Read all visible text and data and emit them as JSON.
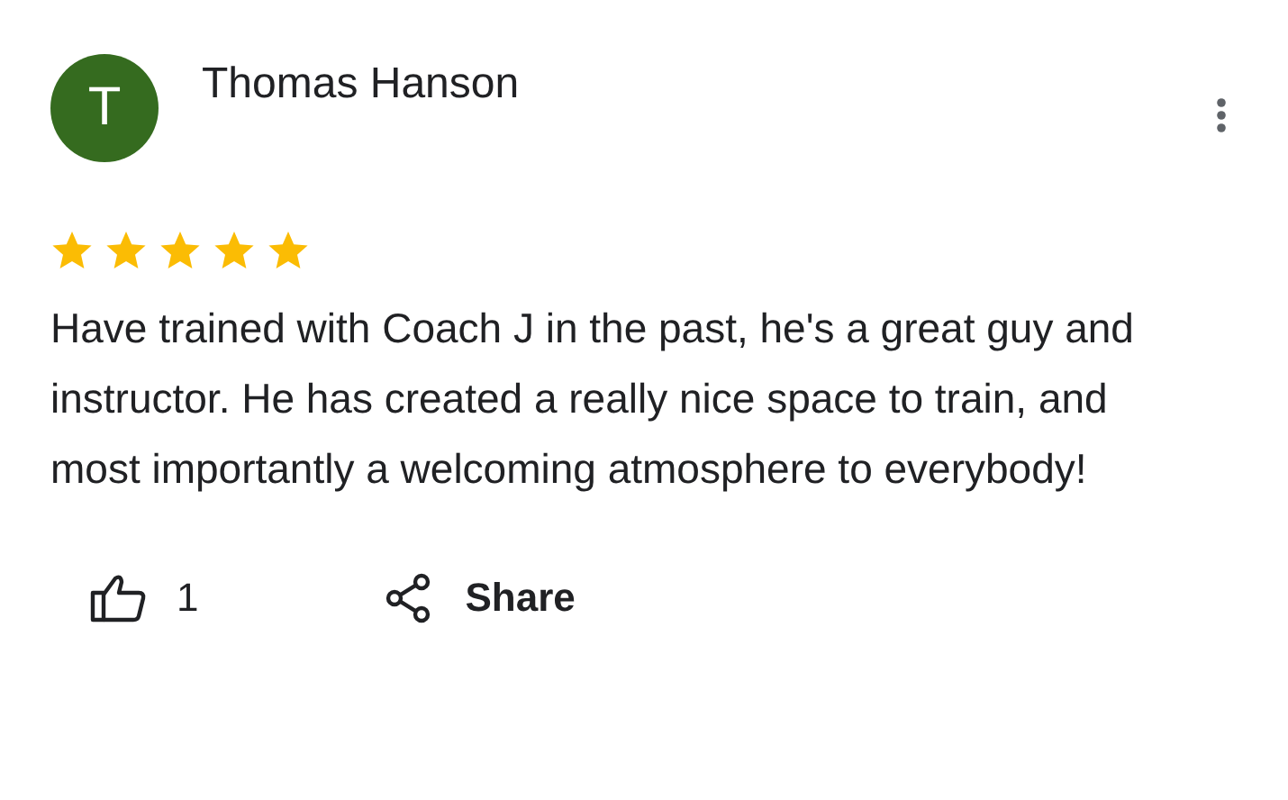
{
  "review": {
    "avatar_letter": "T",
    "author": "Thomas Hanson",
    "stars": 5,
    "text": "Have trained with Coach J in the past, he's a great guy and instructor. He has created a really nice space to train, and most importantly a welcoming atmosphere to everybody!",
    "likes": "1",
    "share_label": "Share"
  }
}
